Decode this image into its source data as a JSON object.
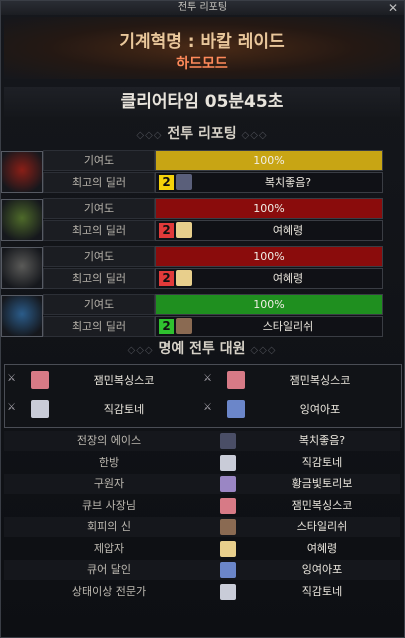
{
  "window": {
    "title": "전투 리포팅",
    "close": "✕"
  },
  "banner": {
    "dungeon": "기계혁명 : 바칼 레이드",
    "mode": "하드모드"
  },
  "clear_time": "클리어타임  05분45초",
  "sections": {
    "report": "전투 리포팅",
    "honor": "명예 전투 대원"
  },
  "parties": [
    {
      "contrib_label": "기여도",
      "contrib_value": "100%",
      "contrib_fraction": 1.0,
      "bar_color": "#c8a514",
      "dealer_label": "최고의 딜러",
      "rank": "2",
      "rank_color": "#f5d20a",
      "dealer": "복치좋음?"
    },
    {
      "contrib_label": "기여도",
      "contrib_value": "100%",
      "contrib_fraction": 1.0,
      "bar_color": "#8a0c0c",
      "dealer_label": "최고의 딜러",
      "rank": "2",
      "rank_color": "#e23a3a",
      "dealer": "여혜령"
    },
    {
      "contrib_label": "기여도",
      "contrib_value": "100%",
      "contrib_fraction": 1.0,
      "bar_color": "#8a0c0c",
      "dealer_label": "최고의 딜러",
      "rank": "2",
      "rank_color": "#e23a3a",
      "dealer": "여혜령"
    },
    {
      "contrib_label": "기여도",
      "contrib_value": "100%",
      "contrib_fraction": 1.0,
      "bar_color": "#1f8f1f",
      "dealer_label": "최고의 딜러",
      "rank": "2",
      "rank_color": "#2fc12f",
      "dealer": "스타일리쉬"
    }
  ],
  "honor": [
    "잼민복싱스코",
    "잼민복싱스코",
    "직감토네",
    "잉여아포"
  ],
  "awards": [
    {
      "name": "전장의 에이스",
      "winner": "복치좋음?"
    },
    {
      "name": "한방",
      "winner": "직감토네"
    },
    {
      "name": "구원자",
      "winner": "황금빛토리보"
    },
    {
      "name": "큐브 사장님",
      "winner": "잼민복싱스코"
    },
    {
      "name": "회피의 신",
      "winner": "스타일리쉬"
    },
    {
      "name": "제압자",
      "winner": "여혜령"
    },
    {
      "name": "큐어 달인",
      "winner": "잉여아포"
    },
    {
      "name": "상태이상 전문가",
      "winner": "직감토네"
    }
  ]
}
